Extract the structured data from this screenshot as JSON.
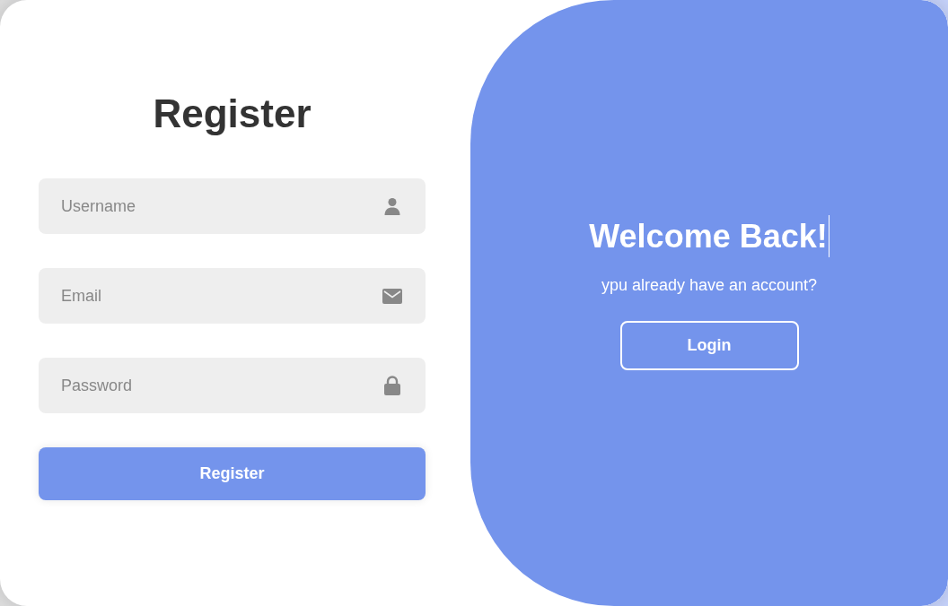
{
  "register_form": {
    "title": "Register",
    "fields": [
      {
        "kind": "text",
        "placeholder": "Username"
      },
      {
        "kind": "email",
        "placeholder": "Email"
      },
      {
        "kind": "password",
        "placeholder": "Password"
      }
    ],
    "submit_button": "Register"
  },
  "welcome_panel": {
    "title": "Welcome Back!",
    "message": "ypu already have an account?",
    "login_button": "Login"
  }
}
